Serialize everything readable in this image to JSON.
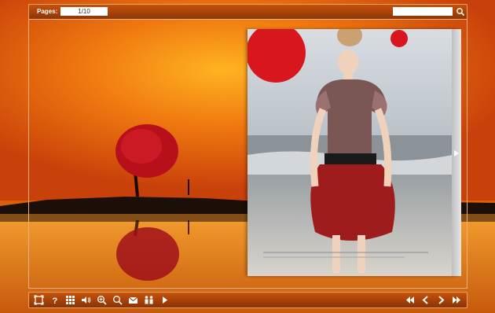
{
  "topbar": {
    "pages_label": "Pages:",
    "page_indicator": "1/10",
    "search_value": ""
  },
  "toolbar_left": [
    "fit-window-icon",
    "help-icon",
    "thumbnails-icon",
    "sound-icon",
    "zoom-in-icon",
    "search-icon",
    "email-icon",
    "share-icon",
    "autoplay-icon"
  ],
  "toolbar_right": [
    "first-page-icon",
    "previous-page-icon",
    "next-page-icon",
    "last-page-icon"
  ],
  "colors": {
    "accent": "#c5520a",
    "bar_dark": "#8a3306",
    "border": "#e9a06a",
    "tree_red": "#c8121a",
    "skirt_red": "#9e1c1c"
  }
}
